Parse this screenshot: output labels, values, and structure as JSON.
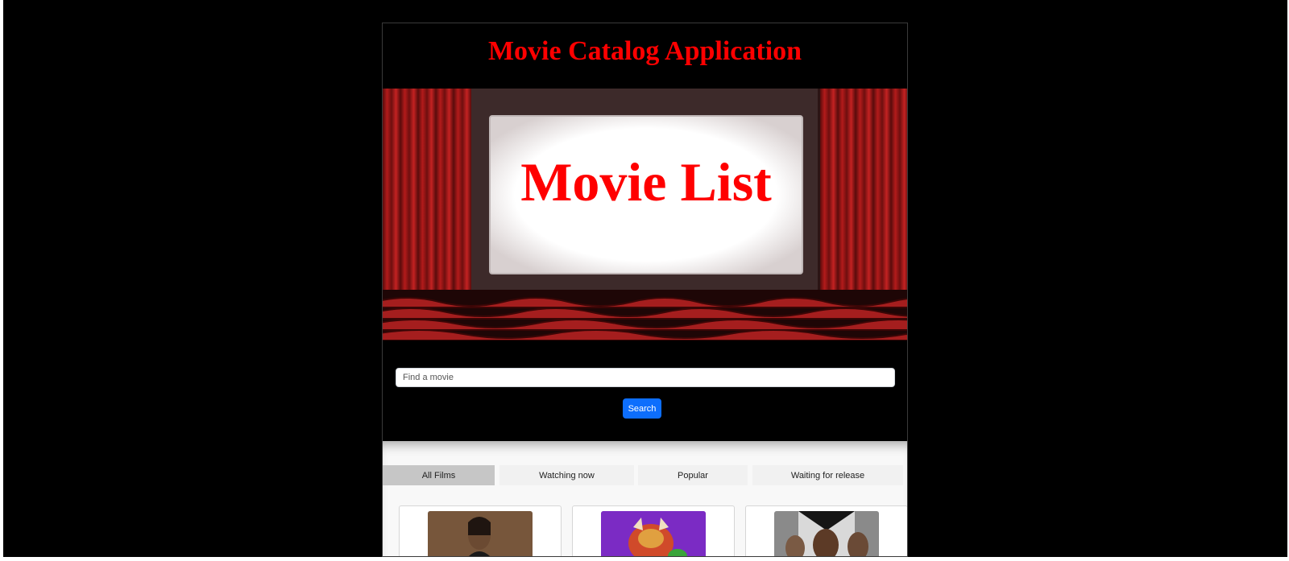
{
  "app": {
    "title": "Movie Catalog Application"
  },
  "hero": {
    "title": "Movie List"
  },
  "search": {
    "placeholder": "Find a movie",
    "button_label": "Search"
  },
  "tabs": [
    {
      "label": "All Films",
      "active": true
    },
    {
      "label": "Watching now",
      "active": false
    },
    {
      "label": "Popular",
      "active": false
    },
    {
      "label": "Waiting for release",
      "active": false
    }
  ],
  "movies": [
    {
      "poster": "movie-poster-1"
    },
    {
      "poster": "movie-poster-2"
    },
    {
      "poster": "movie-poster-3"
    }
  ],
  "colors": {
    "title": "#ff0000",
    "button": "#0d6efd",
    "active_tab": "#c6c6c6",
    "background": "#000000"
  }
}
